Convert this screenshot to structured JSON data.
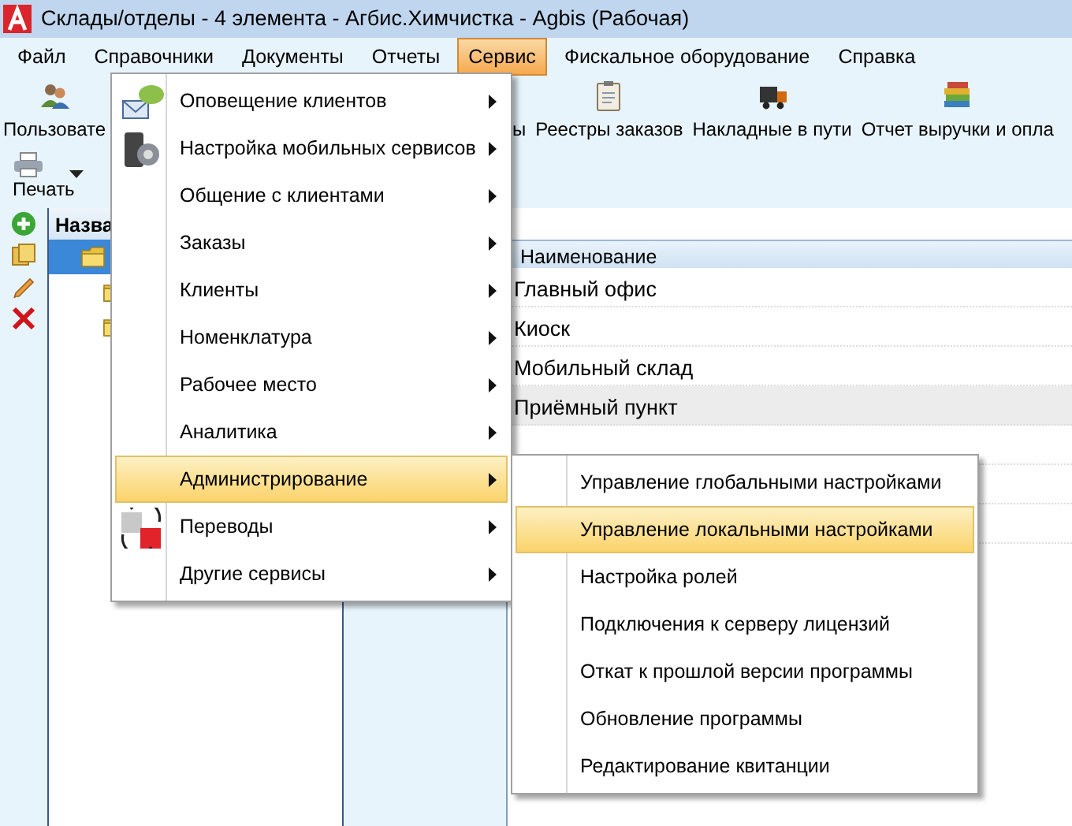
{
  "window": {
    "title": "Склады/отделы - 4 элемента - Агбис.Химчистка - Agbis (Рабочая)"
  },
  "menu_bar": [
    {
      "label": "Файл",
      "selected": false
    },
    {
      "label": "Справочники",
      "selected": false
    },
    {
      "label": "Документы",
      "selected": false
    },
    {
      "label": "Отчеты",
      "selected": false
    },
    {
      "label": "Сервис",
      "selected": true
    },
    {
      "label": "Фискальное оборудование",
      "selected": false
    },
    {
      "label": "Справка",
      "selected": false
    }
  ],
  "toolbar": [
    {
      "label": "Пользовате",
      "kind": "users"
    },
    {
      "label": "ы",
      "kind": "none"
    },
    {
      "label": "Реестры заказов",
      "kind": "clipboard"
    },
    {
      "label": "Накладные в пути",
      "kind": "truck"
    },
    {
      "label": "Отчет выручки и опла",
      "kind": "books"
    }
  ],
  "print_button": {
    "label": "Печать"
  },
  "tree": {
    "header": "Назва",
    "items": [
      {
        "selected": true,
        "children": [
          {
            "selected": false
          },
          {
            "selected": false
          }
        ]
      }
    ]
  },
  "grid": {
    "column": "Наименование",
    "rows": [
      {
        "name": "Главный офис",
        "selected": false
      },
      {
        "name": "Киоск",
        "selected": false
      },
      {
        "name": "Мобильный склад",
        "selected": false
      },
      {
        "name": "Приёмный пункт",
        "selected": true
      }
    ]
  },
  "service_menu": [
    {
      "label": "Оповещение клиентов",
      "kind": "sms",
      "selected": false
    },
    {
      "label": "Настройка мобильных сервисов",
      "kind": "mobile",
      "selected": false
    },
    {
      "label": "Общение с клиентами",
      "kind": "plain",
      "selected": false
    },
    {
      "label": "Заказы",
      "kind": "plain",
      "selected": false
    },
    {
      "label": "Клиенты",
      "kind": "plain",
      "selected": false
    },
    {
      "label": "Номенклатура",
      "kind": "plain",
      "selected": false
    },
    {
      "label": "Рабочее место",
      "kind": "plain",
      "selected": false
    },
    {
      "label": "Аналитика",
      "kind": "plain",
      "selected": false
    },
    {
      "label": "Администрирование",
      "kind": "plain",
      "selected": true
    },
    {
      "label": "Переводы",
      "kind": "translate",
      "selected": false
    },
    {
      "label": "Другие сервисы",
      "kind": "plain",
      "selected": false
    }
  ],
  "admin_submenu": [
    {
      "label": "Управление глобальными настройками",
      "selected": false
    },
    {
      "label": "Управление локальными настройками",
      "selected": true
    },
    {
      "label": "Настройка ролей",
      "selected": false
    },
    {
      "label": "Подключения к серверу лицензий",
      "selected": false
    },
    {
      "label": "Откат к прошлой версии программы",
      "selected": false
    },
    {
      "label": "Обновление программы",
      "selected": false
    },
    {
      "label": "Редактирование квитанции",
      "selected": false
    }
  ]
}
